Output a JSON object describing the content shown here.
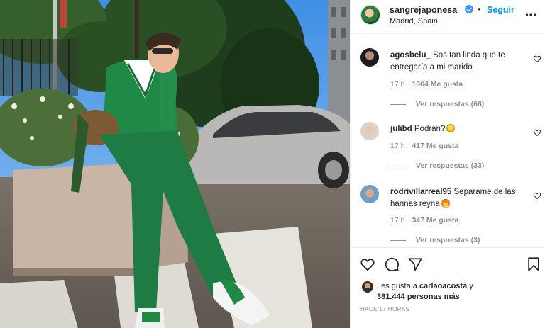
{
  "post": {
    "username": "sangrejaponesa",
    "follow_label": "Seguir",
    "separator": "•",
    "location": "Madrid, Spain",
    "verified": true
  },
  "comments": [
    {
      "username": "agosbelu_",
      "text": "Sos tan linda que te entregaría a mi marido",
      "time": "17 h",
      "likes": "1964 Me gusta",
      "replies": "Ver respuestas (68)"
    },
    {
      "username": "julibd",
      "text": "Podrán?",
      "emoji": "star-struck-emoji",
      "time": "17 h",
      "likes": "417 Me gusta",
      "replies": "Ver respuestas (33)"
    },
    {
      "username": "rodrivillarreal95",
      "text": "Separame de las harinas reyna",
      "emoji": "fire-emoji",
      "time": "17 h",
      "likes": "347 Me gusta",
      "replies": "Ver respuestas (3)"
    }
  ],
  "liked_by": {
    "prefix": "Les gusta a",
    "user": "carlaoacosta",
    "suffix": "y",
    "others": "381.444 personas más"
  },
  "timestamp": "HACE 17 HORAS",
  "colors": {
    "link_blue": "#0095f6",
    "verified_blue": "#3897f0",
    "text": "#262626",
    "muted": "#8e8e8e",
    "divider": "#efefef"
  },
  "icons": [
    "more-options-icon",
    "heart-icon",
    "comment-icon",
    "share-icon",
    "bookmark-icon",
    "verified-badge-icon"
  ]
}
